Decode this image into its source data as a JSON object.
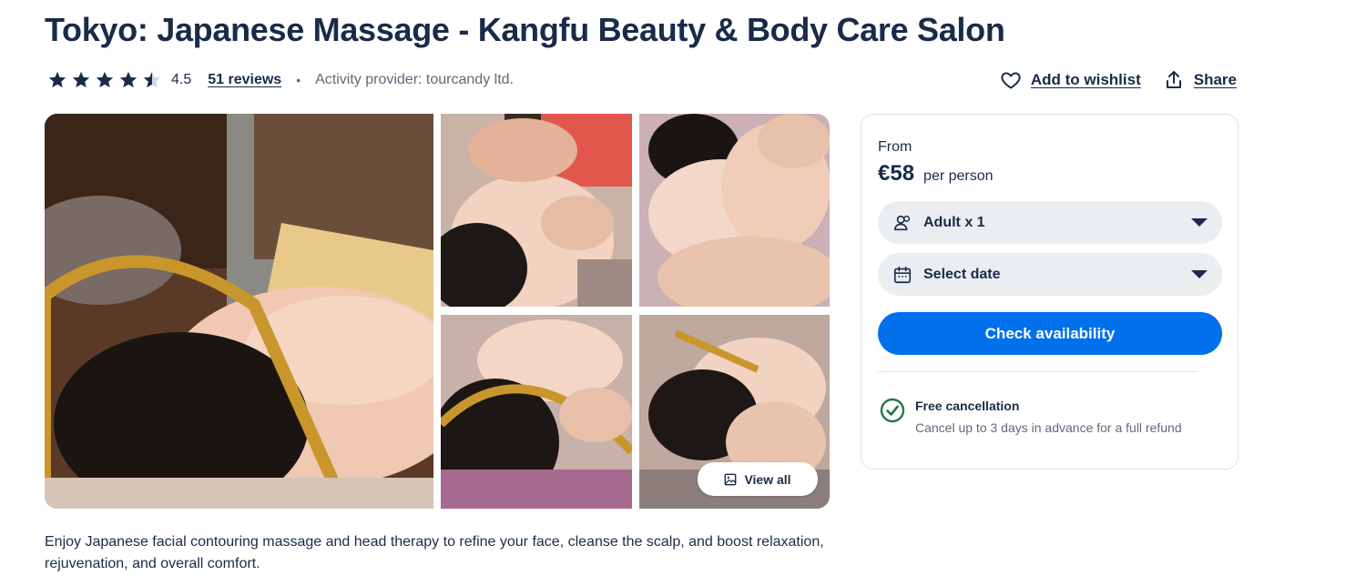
{
  "header": {
    "title": "Tokyo: Japanese Massage - Kangfu Beauty & Body Care Salon",
    "rating_value": "4.5",
    "rating_stars": 4.5,
    "reviews_label": "51 reviews",
    "separator": "•",
    "provider": "Activity provider: tourcandy ltd.",
    "wishlist_label": "Add to wishlist",
    "share_label": "Share"
  },
  "gallery": {
    "view_all_label": "View all",
    "photos": [
      "main-photo-head-spa",
      "photo-facial-massage",
      "photo-shoulder-massage",
      "photo-head-spa-comb",
      "photo-facial-roller"
    ]
  },
  "description": "Enjoy Japanese facial contouring massage and head therapy to refine your face, cleanse the scalp, and boost relaxation, rejuvenation, and overall comfort.",
  "booking": {
    "from_label": "From",
    "price": "€58",
    "per_label": "per person",
    "participants_label": "Adult x 1",
    "date_label": "Select date",
    "cta_label": "Check availability",
    "free_cancellation_title": "Free cancellation",
    "free_cancellation_text": "Cancel up to 3 days in advance for a full refund"
  },
  "colors": {
    "text": "#1a2b49",
    "muted": "#63687a",
    "accent": "#0071eb",
    "success": "#1f7a4d",
    "field_bg": "#ebeef1"
  }
}
